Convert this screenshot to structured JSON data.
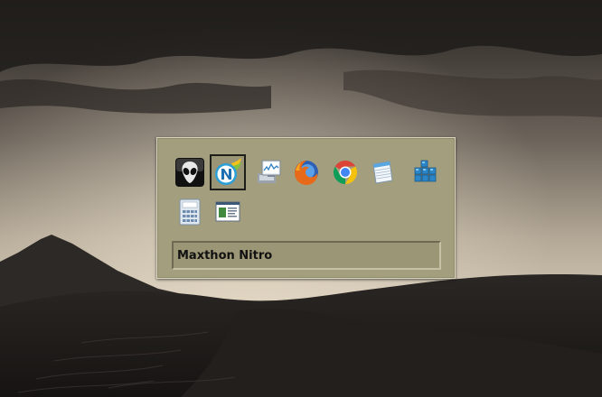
{
  "switcher": {
    "selected_title": "Maxthon Nitro",
    "apps": [
      {
        "icon": "foobar2000-alien-icon",
        "selected": false
      },
      {
        "icon": "maxthon-nitro-icon",
        "selected": true
      },
      {
        "icon": "resource-monitor-icon",
        "selected": false
      },
      {
        "icon": "firefox-icon",
        "selected": false
      },
      {
        "icon": "chrome-icon",
        "selected": false
      },
      {
        "icon": "notepad-icon",
        "selected": false
      },
      {
        "icon": "registry-editor-icon",
        "selected": false
      },
      {
        "icon": "calculator-icon",
        "selected": false
      },
      {
        "icon": "window-app-icon",
        "selected": false
      }
    ]
  },
  "colors": {
    "panel_bg": "#a39f7e",
    "panel_border": "#d8d6c0",
    "title_text": "#111111"
  }
}
